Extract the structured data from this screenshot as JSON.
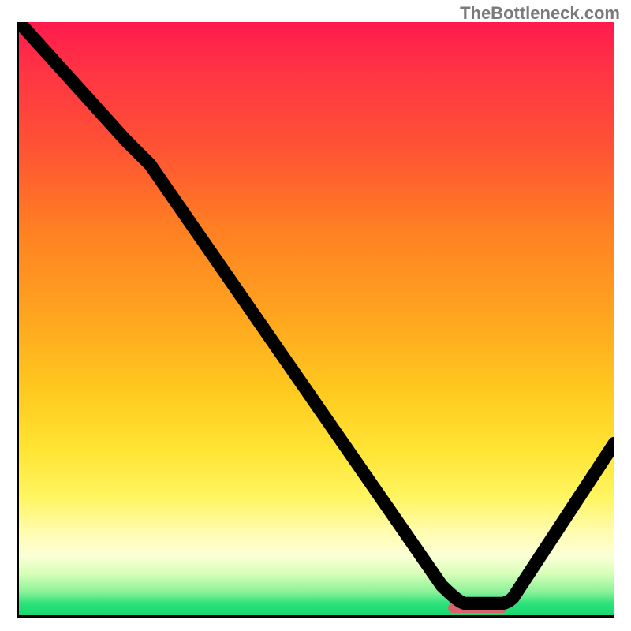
{
  "watermark": "TheBottleneck.com",
  "chart_data": {
    "type": "line",
    "title": "",
    "xlabel": "",
    "ylabel": "",
    "xlim": [
      0,
      100
    ],
    "ylim": [
      0,
      100
    ],
    "grid": false,
    "legend": false,
    "background": "heatmap-gradient-red-to-green",
    "series": [
      {
        "name": "bottleneck-curve",
        "x": [
          0,
          20,
          74,
          82,
          100
        ],
        "y": [
          100,
          78,
          2,
          2,
          29
        ]
      }
    ],
    "marker": {
      "name": "optimal-range",
      "x_start": 72,
      "x_end": 82,
      "y": 1.2,
      "color": "#d9636b"
    },
    "gradient_stops": [
      {
        "pct": 0,
        "color": "#ff1a4d"
      },
      {
        "pct": 8,
        "color": "#ff3344"
      },
      {
        "pct": 22,
        "color": "#ff5533"
      },
      {
        "pct": 35,
        "color": "#ff8022"
      },
      {
        "pct": 50,
        "color": "#ffa61f"
      },
      {
        "pct": 62,
        "color": "#ffc91f"
      },
      {
        "pct": 72,
        "color": "#ffe433"
      },
      {
        "pct": 80,
        "color": "#fff560"
      },
      {
        "pct": 86,
        "color": "#fffcb0"
      },
      {
        "pct": 90,
        "color": "#fcffd6"
      },
      {
        "pct": 93,
        "color": "#d6ffb8"
      },
      {
        "pct": 96,
        "color": "#8ef29a"
      },
      {
        "pct": 98,
        "color": "#2de37a"
      },
      {
        "pct": 100,
        "color": "#17d86f"
      }
    ]
  }
}
